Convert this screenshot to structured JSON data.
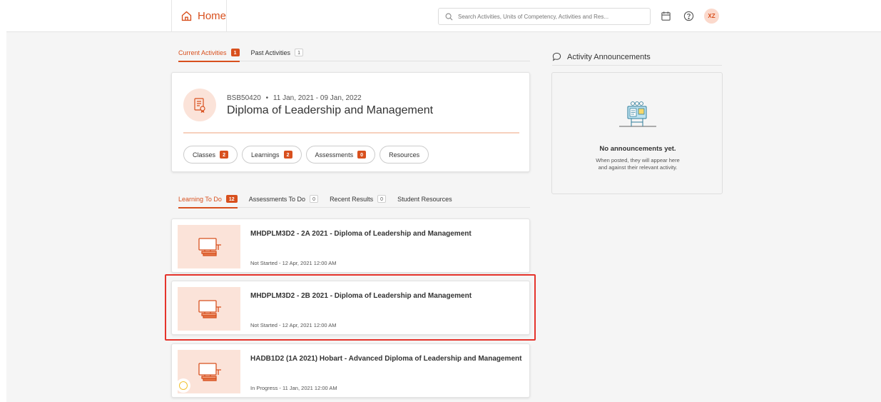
{
  "header": {
    "home_label": "Home",
    "search_placeholder": "Search Activities, Units of Competency, Activities and Res...",
    "avatar_initials": "XZ"
  },
  "activity_tabs": [
    {
      "label": "Current Activities",
      "count": "1",
      "active": true
    },
    {
      "label": "Past Activities",
      "count": "1",
      "active": false
    }
  ],
  "course": {
    "code": "BSB50420",
    "dates": "11 Jan, 2021 - 09 Jan, 2022",
    "title": "Diploma of Leadership and Management",
    "pills": [
      {
        "label": "Classes",
        "count": "2"
      },
      {
        "label": "Learnings",
        "count": "2"
      },
      {
        "label": "Assessments",
        "count": "0"
      },
      {
        "label": "Resources"
      }
    ]
  },
  "todo_tabs": [
    {
      "label": "Learning To Do",
      "count": "12",
      "active": true
    },
    {
      "label": "Assessments To Do",
      "count": "0",
      "active": false
    },
    {
      "label": "Recent Results",
      "count": "0",
      "active": false
    },
    {
      "label": "Student Resources",
      "active": false
    }
  ],
  "activities": [
    {
      "title": "MHDPLM3D2 - 2A 2021 - Diploma of Leadership and Management",
      "status": "Not Started - 12 Apr, 2021 12:00 AM"
    },
    {
      "title": "MHDPLM3D2 - 2B 2021 - Diploma of Leadership and Management",
      "status": "Not Started - 12 Apr, 2021 12:00 AM"
    },
    {
      "title": "HADB1D2 (1A 2021) Hobart - Advanced Diploma of Leadership and Management",
      "status": "In Progress - 11 Jan, 2021 12:00 AM"
    }
  ],
  "announcements": {
    "heading": "Activity Announcements",
    "empty_title": "No announcements yet.",
    "empty_line1": "When posted, they will appear here",
    "empty_line2": "and against their relevant activity."
  },
  "colors": {
    "accent": "#d8501e",
    "highlight": "#e5342c",
    "badge_bg": "#d8501e"
  }
}
